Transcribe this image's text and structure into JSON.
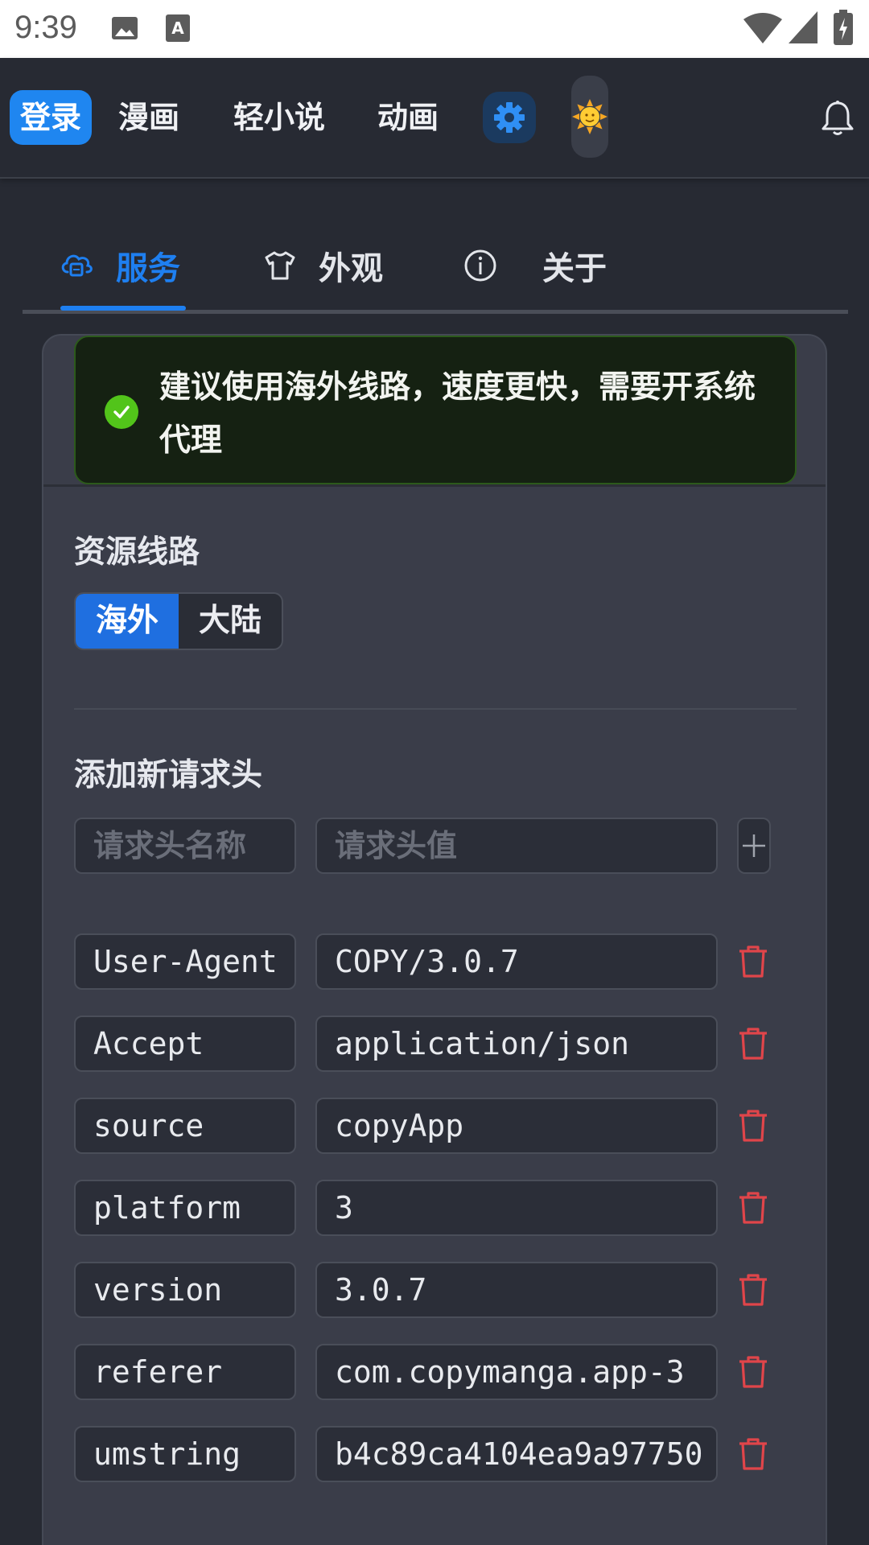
{
  "status_bar": {
    "time": "9:39"
  },
  "nav": {
    "login": "登录",
    "manga": "漫画",
    "novel": "轻小说",
    "anime": "动画"
  },
  "tabs": [
    {
      "label": "服务",
      "icon": "cloud-server-icon",
      "active": true
    },
    {
      "label": "外观",
      "icon": "tshirt-icon",
      "active": false
    },
    {
      "label": "关于",
      "icon": "info-icon",
      "active": false
    }
  ],
  "alert": {
    "text": "建议使用海外线路，速度更快，需要开系统代理",
    "type": "success"
  },
  "route": {
    "title": "资源线路",
    "options": [
      "海外",
      "大陆"
    ],
    "selected": "海外"
  },
  "headers": {
    "title": "添加新请求头",
    "name_placeholder": "请求头名称",
    "value_placeholder": "请求头值",
    "rows": [
      {
        "name": "User-Agent",
        "value": "COPY/3.0.7"
      },
      {
        "name": "Accept",
        "value": "application/json"
      },
      {
        "name": "source",
        "value": "copyApp"
      },
      {
        "name": "platform",
        "value": "3"
      },
      {
        "name": "version",
        "value": "3.0.7"
      },
      {
        "name": "referer",
        "value": "com.copymanga.app-3"
      },
      {
        "name": "umstring",
        "value": "b4c89ca4104ea9a97750"
      }
    ]
  },
  "colors": {
    "accent": "#1f86f0",
    "danger": "#e0454a",
    "success": "#52c41a"
  }
}
